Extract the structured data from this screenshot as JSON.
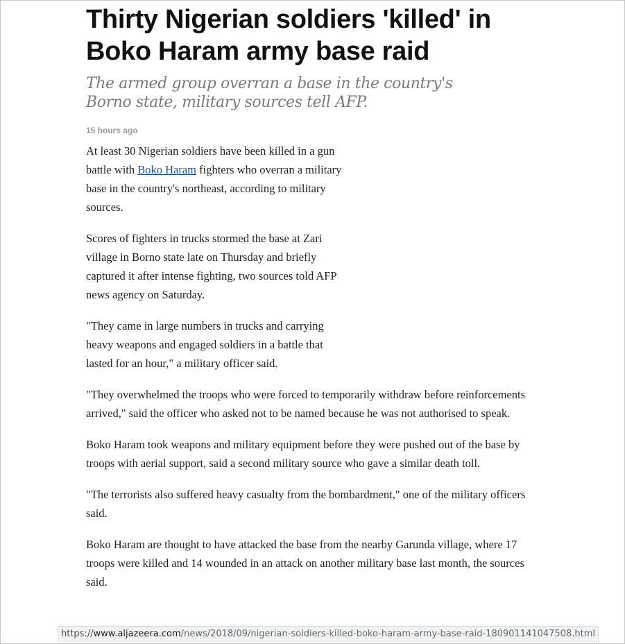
{
  "article": {
    "title": "Thirty Nigerian soldiers 'killed' in Boko Haram army base raid",
    "standfirst": "The armed group overran a base in the country's Borno state, military sources tell AFP.",
    "timestamp": "15 hours ago",
    "paragraphs": [
      {
        "before": "At least 30 Nigerian soldiers have been killed in a gun battle with ",
        "link": "Boko Haram",
        "after": " fighters who overran a military base in the country's northeast, according to military sources."
      },
      {
        "text": "Scores of fighters in trucks stormed the base at Zari village in Borno state late on Thursday and briefly captured it after intense fighting, two sources told AFP news agency on Saturday."
      },
      {
        "text": "\"They came in large numbers in trucks and carrying heavy weapons and engaged soldiers in a battle that lasted for an hour,\" a military officer said."
      },
      {
        "text": "\"They overwhelmed the troops who were forced to temporarily withdraw before reinforcements arrived,\" said the officer who asked not to be named because he was not authorised to speak."
      },
      {
        "text": "Boko Haram took weapons and military equipment before they were pushed out of the base by troops with aerial support, said a second military source who gave a similar death toll."
      },
      {
        "text": "\"The terrorists also suffered heavy casualty from the bombardment,\" one of the military officers said."
      },
      {
        "text": "Boko Haram are thought to have attacked the base from the nearby Garunda village, where 17 troops were killed and 14 wounded in an attack on another military base last month, the sources said."
      }
    ]
  },
  "status_bar": {
    "scheme": "https://",
    "host": "www.aljazeera.com",
    "path": "/news/2018/09/nigerian-soldiers-killed-boko-haram-army-base-raid-180901141047508.html"
  },
  "colors": {
    "headline": "#111111",
    "standfirst": "#7a7a7a",
    "timestamp": "#9a9a9a",
    "body_text": "#222222",
    "link": "#1a4f8a"
  }
}
